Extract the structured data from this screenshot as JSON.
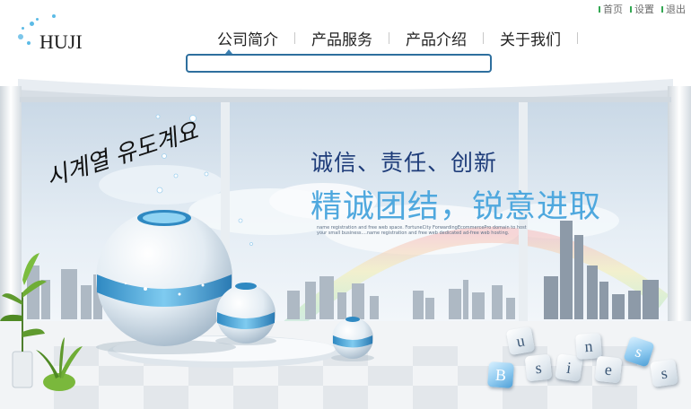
{
  "top_links": [
    {
      "label": "首页"
    },
    {
      "label": "设置"
    },
    {
      "label": "退出"
    }
  ],
  "logo": {
    "text": "HUJI"
  },
  "nav": {
    "items": [
      {
        "label": "公司简介"
      },
      {
        "label": "产品服务"
      },
      {
        "label": "产品介绍"
      },
      {
        "label": "关于我们"
      }
    ]
  },
  "search": {
    "value": "",
    "placeholder": ""
  },
  "hero": {
    "slogan_primary": "诚信、责任、创新",
    "slogan_secondary": "精诚团结，锐意进取",
    "description": "name registration and free web space. FortuneCity ForwardingEcommercePro domain to host your small business....name registration and free web dedicated ad-free web hosting.",
    "calligraphy": "시계열 유도계요",
    "cube_letters": [
      "u",
      "B",
      "s",
      "i",
      "n",
      "e",
      "s",
      "s"
    ]
  },
  "colors": {
    "nav_accent": "#2e6f9e",
    "slogan_primary": "#1f3d7a",
    "slogan_secondary": "#4fa8de",
    "link_dot": "#34a853"
  }
}
